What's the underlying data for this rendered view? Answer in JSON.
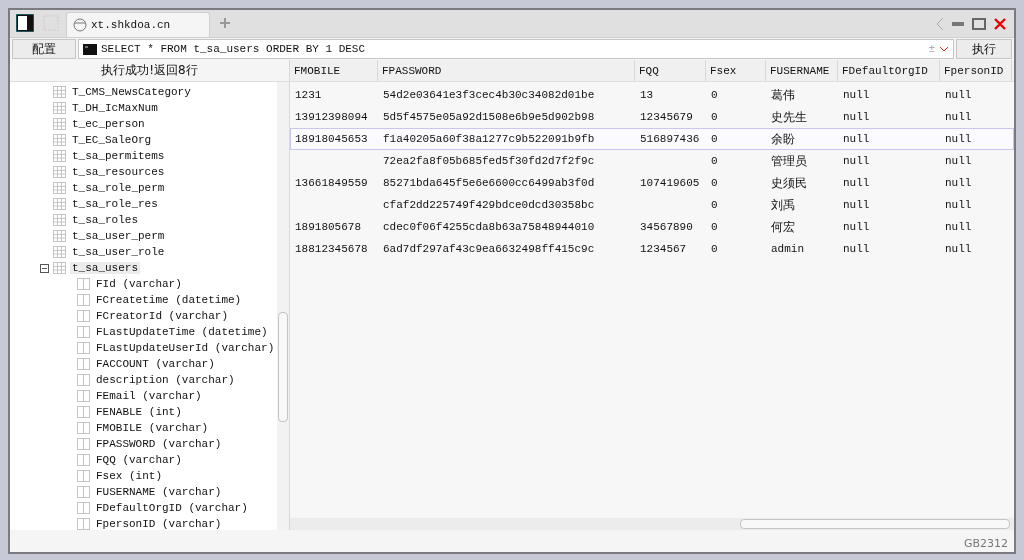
{
  "tab": {
    "title": "xt.shkdoa.cn",
    "selected": true
  },
  "toolbar": {
    "config_button": "配置",
    "query": "SELECT * FROM t_sa_users ORDER BY 1 DESC",
    "plus_minus": "±",
    "run_button": "执行"
  },
  "result_message": "执行成功!返回8行",
  "tree": [
    {
      "label": "T_CMS_NewsCategory",
      "selected": false,
      "expanded": false
    },
    {
      "label": "T_DH_IcMaxNum",
      "selected": false,
      "expanded": false
    },
    {
      "label": "t_ec_person",
      "selected": false,
      "expanded": false
    },
    {
      "label": "T_EC_SaleOrg",
      "selected": false,
      "expanded": false
    },
    {
      "label": "t_sa_permitems",
      "selected": false,
      "expanded": false
    },
    {
      "label": "t_sa_resources",
      "selected": false,
      "expanded": false
    },
    {
      "label": "t_sa_role_perm",
      "selected": false,
      "expanded": false
    },
    {
      "label": "t_sa_role_res",
      "selected": false,
      "expanded": false
    },
    {
      "label": "t_sa_roles",
      "selected": false,
      "expanded": false
    },
    {
      "label": "t_sa_user_perm",
      "selected": false,
      "expanded": false
    },
    {
      "label": "t_sa_user_role",
      "selected": false,
      "expanded": false
    },
    {
      "label": "t_sa_users",
      "selected": true,
      "expanded": true,
      "children": [
        {
          "label": "FId (varchar)"
        },
        {
          "label": "FCreatetime (datetime)"
        },
        {
          "label": "FCreatorId (varchar)"
        },
        {
          "label": "FLastUpdateTime (datetime)"
        },
        {
          "label": "FLastUpdateUserId (varchar)"
        },
        {
          "label": "FACCOUNT (varchar)"
        },
        {
          "label": "description (varchar)"
        },
        {
          "label": "FEmail (varchar)"
        },
        {
          "label": "FENABLE (int)"
        },
        {
          "label": "FMOBILE (varchar)"
        },
        {
          "label": "FPASSWORD (varchar)"
        },
        {
          "label": "FQQ (varchar)"
        },
        {
          "label": "Fsex (int)"
        },
        {
          "label": "FUSERNAME (varchar)"
        },
        {
          "label": "FDefaultOrgID (varchar)"
        },
        {
          "label": "FpersonID (varchar)"
        }
      ]
    }
  ],
  "table": {
    "columns": [
      "FMOBILE",
      "FPASSWORD",
      "FQQ",
      "Fsex",
      "FUSERNAME",
      "FDefaultOrgID",
      "FpersonID"
    ],
    "rows": [
      {
        "selected": false,
        "cells": [
          "1231",
          "54d2e03641e3f3cec4b30c34082d01be",
          "13",
          "0",
          "葛伟",
          "null",
          "null"
        ]
      },
      {
        "selected": false,
        "cells": [
          "13912398094",
          "5d5f4575e05a92d1508e6b9e5d902b98",
          "12345679",
          "0",
          "史先生",
          "null",
          "null"
        ]
      },
      {
        "selected": true,
        "cells": [
          "18918045653",
          "f1a40205a60f38a1277c9b522091b9fb",
          "516897436",
          "0",
          "余盼",
          "null",
          "null"
        ]
      },
      {
        "selected": false,
        "cells": [
          "",
          "72ea2fa8f05b685fed5f30fd2d7f2f9c",
          "",
          "0",
          "管理员",
          "null",
          "null"
        ]
      },
      {
        "selected": false,
        "cells": [
          "13661849559",
          "85271bda645f5e6e6600cc6499ab3f0d",
          "107419605",
          "0",
          "史须民",
          "null",
          "null"
        ]
      },
      {
        "selected": false,
        "cells": [
          "",
          "cfaf2dd225749f429bdce0dcd30358bc",
          "",
          "0",
          "刘禹",
          "null",
          "null"
        ]
      },
      {
        "selected": false,
        "cells": [
          "1891805678",
          "cdec0f06f4255cda8b63a75848944010",
          "34567890",
          "0",
          "何宏",
          "null",
          "null"
        ]
      },
      {
        "selected": false,
        "cells": [
          "18812345678",
          "6ad7df297af43c9ea6632498ff415c9c",
          "1234567",
          "0",
          "admin",
          "null",
          "null"
        ]
      }
    ]
  },
  "status": {
    "encoding": "GB2312"
  }
}
